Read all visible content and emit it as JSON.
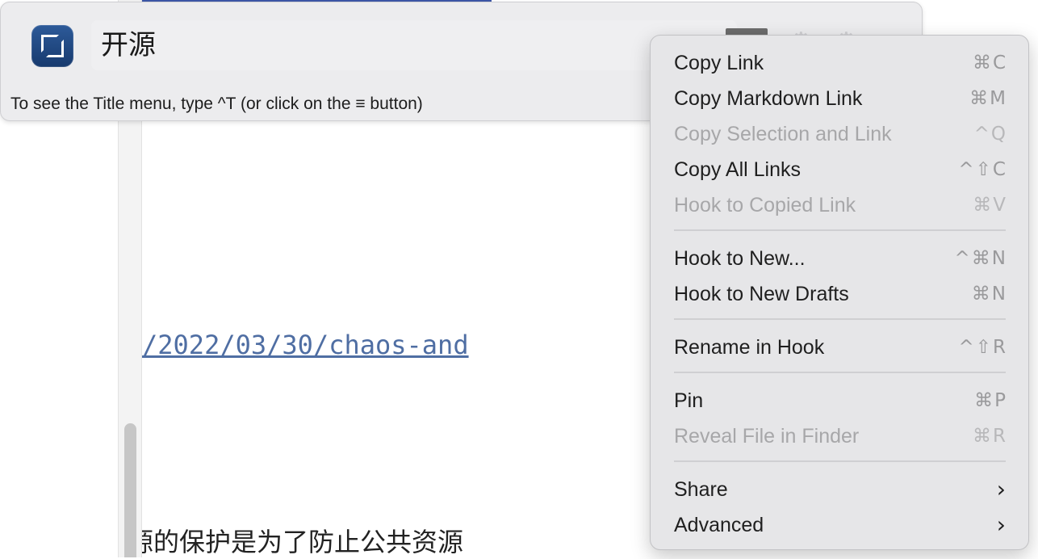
{
  "document": {
    "link_text": "/2022/03/30/chaos-and",
    "body_text": "源的保护是为了防止公共资源"
  },
  "hook_window": {
    "title_value": "开源",
    "hint": "To see the Title menu, type ^T (or click on the ≡ button)"
  },
  "icons": {
    "app": "hook-app-icon",
    "menu_button": "hamburger-icon",
    "settings_a": "gear-icon",
    "settings_b": "gear-icon",
    "submenu": "chevron-right-icon"
  },
  "colors": {
    "accent_link": "#4f6ea3",
    "menu_bg": "#e6e6e8",
    "disabled_text": "#a7a7a9"
  },
  "menu": {
    "items": [
      {
        "label": "Copy Link",
        "shortcut": "⌘C",
        "enabled": true
      },
      {
        "label": "Copy Markdown Link",
        "shortcut": "⌘M",
        "enabled": true
      },
      {
        "label": "Copy Selection and Link",
        "shortcut": "^Q",
        "enabled": false
      },
      {
        "label": "Copy All Links",
        "shortcut": "^⇧C",
        "enabled": true
      },
      {
        "label": "Hook to Copied Link",
        "shortcut": "⌘V",
        "enabled": false
      },
      {
        "label": "Hook to New...",
        "shortcut": "^⌘N",
        "enabled": true
      },
      {
        "label": "Hook to New Drafts",
        "shortcut": "⌘N",
        "enabled": true
      },
      {
        "label": "Rename in Hook",
        "shortcut": "^⇧R",
        "enabled": true
      },
      {
        "label": "Pin",
        "shortcut": "⌘P",
        "enabled": true
      },
      {
        "label": "Reveal File in Finder",
        "shortcut": "⌘R",
        "enabled": false
      },
      {
        "label": "Share",
        "shortcut": "",
        "enabled": true
      },
      {
        "label": "Advanced",
        "shortcut": "",
        "enabled": true
      }
    ]
  }
}
